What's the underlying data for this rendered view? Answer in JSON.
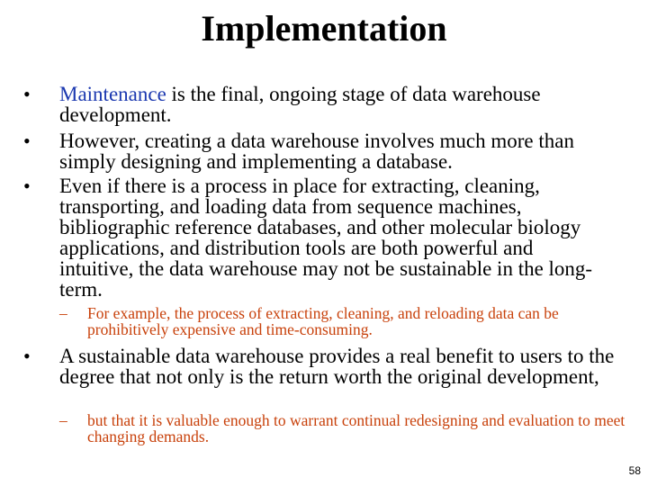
{
  "slide": {
    "title": "Implementation",
    "bullets": [
      {
        "highlight": "Maintenance",
        "text": " is the final, ongoing stage of data warehouse development."
      },
      {
        "text": "However, creating a data warehouse involves much more than simply designing and implementing a database."
      },
      {
        "text": "Even if there is a process in place for extracting, cleaning, transporting, and loading data from sequence machines, bibliographic reference databases, and other molecular biology applications, and distribution tools are both powerful and intuitive, the data warehouse may not be sustainable in the long-term."
      },
      {
        "text": "A sustainable data warehouse provides a real benefit to users to the degree that not only is the return worth the original development,"
      }
    ],
    "sub_bullets": [
      {
        "text": "For example, the process of extracting, cleaning, and reloading data can be prohibitively expensive and time-consuming."
      },
      {
        "text": "but that it is valuable enough to warrant continual redesigning and evaluation to meet changing demands."
      }
    ],
    "bullet_symbol": "•",
    "sub_bullet_symbol": "–",
    "page_number": "58",
    "colors": {
      "highlight": "#1c39b0",
      "sub_bullet": "#c8410b",
      "text": "#000000"
    }
  }
}
